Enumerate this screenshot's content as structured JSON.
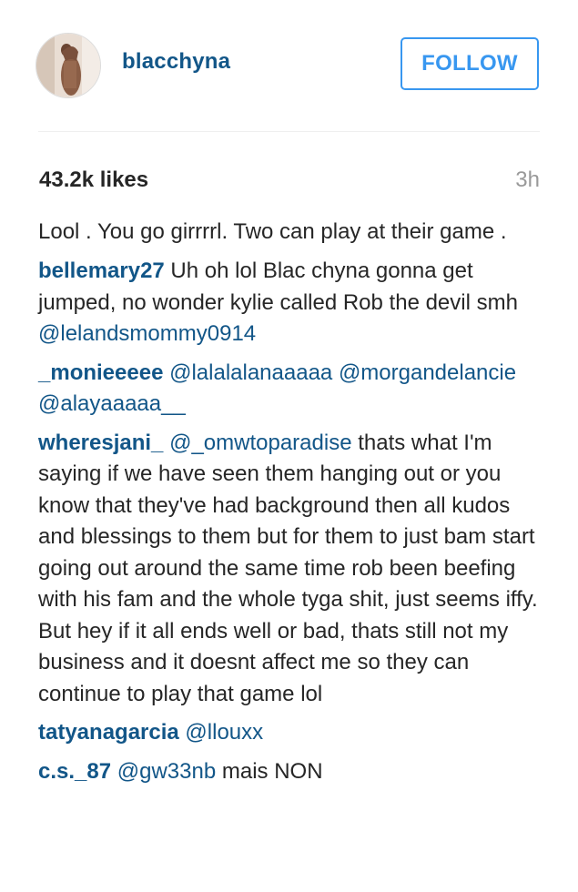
{
  "post": {
    "username": "blacchyna",
    "follow_label": "FOLLOW",
    "likes": "43.2k likes",
    "time": "3h"
  },
  "comments": [
    {
      "user": "",
      "segments": [
        {
          "t": "text",
          "v": "Lool . You go girrrrl. Two can play at their game ."
        }
      ]
    },
    {
      "user": "bellemary27",
      "segments": [
        {
          "t": "text",
          "v": " Uh oh lol Blac chyna gonna get jumped, no wonder kylie called Rob the devil smh "
        },
        {
          "t": "mention",
          "v": "@lelandsmommy0914"
        }
      ]
    },
    {
      "user": "_monieeeee",
      "segments": [
        {
          "t": "text",
          "v": " "
        },
        {
          "t": "mention",
          "v": "@lalalalanaaaaa"
        },
        {
          "t": "text",
          "v": " "
        },
        {
          "t": "mention",
          "v": "@morgandelancie"
        },
        {
          "t": "text",
          "v": " "
        },
        {
          "t": "mention",
          "v": "@alayaaaaa__"
        }
      ]
    },
    {
      "user": "wheresjani_",
      "segments": [
        {
          "t": "text",
          "v": " "
        },
        {
          "t": "mention",
          "v": "@_omwtoparadise"
        },
        {
          "t": "text",
          "v": " thats what I'm saying if we have seen them hanging out or you know that they've had background then all kudos and blessings to them but for them to just bam start going out around the same time rob been beefing with his fam and the whole tyga shit, just seems iffy. But hey if it all ends well or bad, thats still not my business and it doesnt affect me so they can continue to play that game lol"
        }
      ]
    },
    {
      "user": "tatyanagarcia",
      "segments": [
        {
          "t": "text",
          "v": " "
        },
        {
          "t": "mention",
          "v": "@llouxx"
        }
      ]
    },
    {
      "user": "c.s._87",
      "segments": [
        {
          "t": "text",
          "v": " "
        },
        {
          "t": "mention",
          "v": "@gw33nb"
        },
        {
          "t": "text",
          "v": " mais NON"
        }
      ]
    }
  ],
  "colors": {
    "username": "#125688",
    "follow": "#3897f0",
    "text": "#262626",
    "muted": "#999999"
  }
}
